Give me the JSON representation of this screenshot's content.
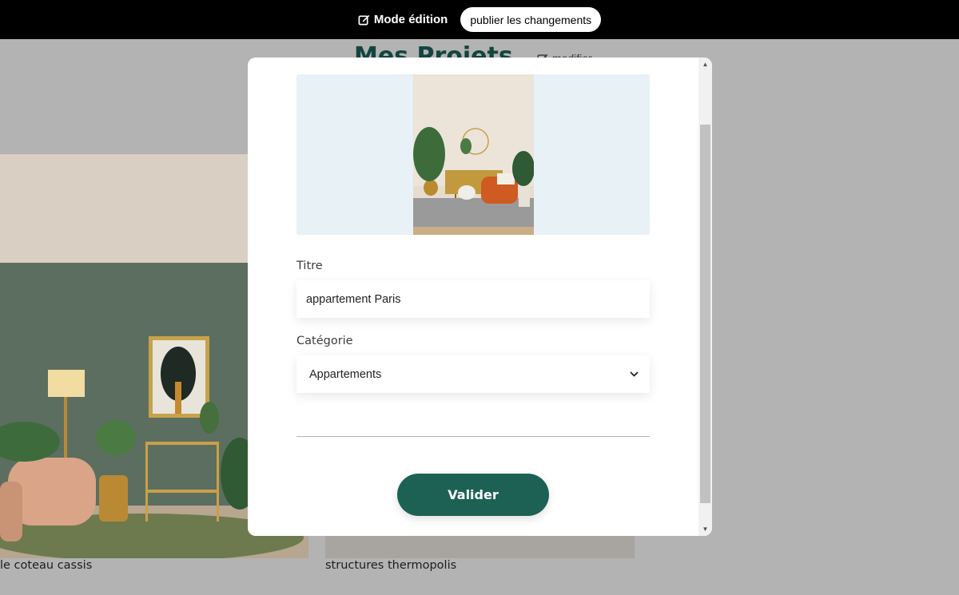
{
  "topbar": {
    "edit_mode_label": "Mode édition",
    "edit_icon": "edit-icon",
    "publish_label": "publier les changements"
  },
  "page": {
    "section_title": "Mes Projets",
    "modify_label": "modifier",
    "works": [
      {
        "caption": "le coteau cassis"
      },
      {
        "caption": "structures thermopolis"
      }
    ]
  },
  "modal": {
    "title_label": "Titre",
    "title_value": "appartement Paris",
    "category_label": "Catégorie",
    "category_selected": "Appartements",
    "submit_label": "Valider"
  },
  "colors": {
    "accent": "#1d6154",
    "title": "#124540",
    "preview_bg": "#e8f1f6",
    "overlay": "#b3b3b3"
  }
}
